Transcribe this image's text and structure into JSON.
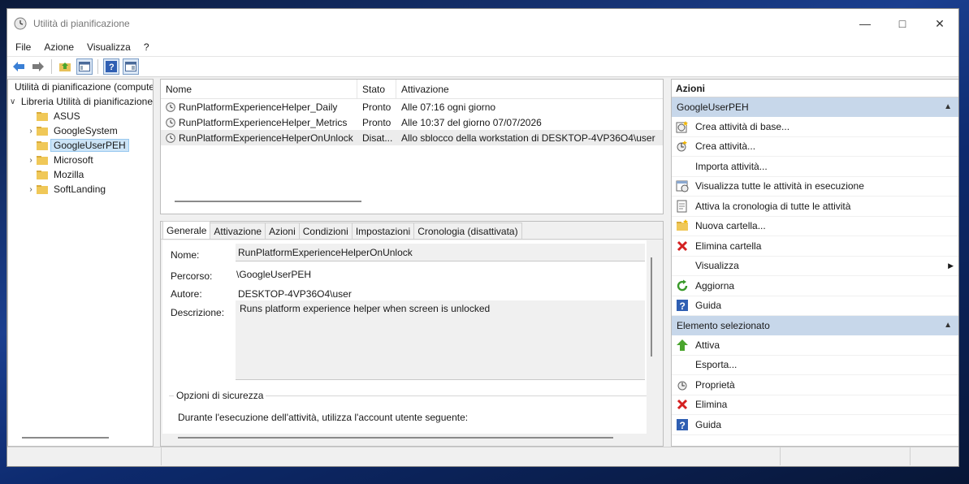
{
  "window": {
    "title": "Utilità di pianificazione"
  },
  "menu": {
    "items": [
      "File",
      "Azione",
      "Visualizza",
      "?"
    ]
  },
  "tree": {
    "root": "Utilità di pianificazione (computer locale)",
    "library": "Libreria Utilità di pianificazione",
    "children": [
      {
        "label": "ASUS",
        "expandable": false
      },
      {
        "label": "GoogleSystem",
        "expandable": true
      },
      {
        "label": "GoogleUserPEH",
        "expandable": false,
        "selected": true
      },
      {
        "label": "Microsoft",
        "expandable": true
      },
      {
        "label": "Mozilla",
        "expandable": false
      },
      {
        "label": "SoftLanding",
        "expandable": true
      }
    ]
  },
  "task_list": {
    "columns": [
      "Nome",
      "Stato",
      "Attivazione"
    ],
    "rows": [
      {
        "name": "RunPlatformExperienceHelper_Daily",
        "status": "Pronto",
        "trigger": "Alle 07:16 ogni giorno"
      },
      {
        "name": "RunPlatformExperienceHelper_Metrics",
        "status": "Pronto",
        "trigger": "Alle 10:37 del giorno 07/07/2026"
      },
      {
        "name": "RunPlatformExperienceHelperOnUnlock",
        "status": "Disat...",
        "trigger": "Allo sblocco della workstation di DESKTOP-4VP36O4\\user"
      }
    ]
  },
  "detail": {
    "tabs": [
      "Generale",
      "Attivazione",
      "Azioni",
      "Condizioni",
      "Impostazioni",
      "Cronologia (disattivata)"
    ],
    "name_label": "Nome:",
    "name_value": "RunPlatformExperienceHelperOnUnlock",
    "path_label": "Percorso:",
    "path_value": "\\GoogleUserPEH",
    "author_label": "Autore:",
    "author_value": "DESKTOP-4VP36O4\\user",
    "desc_label": "Descrizione:",
    "desc_value": "Runs platform experience helper when screen is unlocked",
    "security_group": "Opzioni di sicurezza",
    "security_text": "Durante l'esecuzione dell'attività, utilizza l'account utente seguente:"
  },
  "actions": {
    "title": "Azioni",
    "section1": "GoogleUserPEH",
    "section1_items": [
      "Crea attività di base...",
      "Crea attività...",
      "Importa attività...",
      "Visualizza tutte le attività in esecuzione",
      "Attiva la cronologia di tutte le attività",
      "Nuova cartella...",
      "Elimina cartella",
      "Visualizza",
      "Aggiorna",
      "Guida"
    ],
    "section2": "Elemento selezionato",
    "section2_items": [
      "Attiva",
      "Esporta...",
      "Proprietà",
      "Elimina",
      "Guida"
    ]
  }
}
